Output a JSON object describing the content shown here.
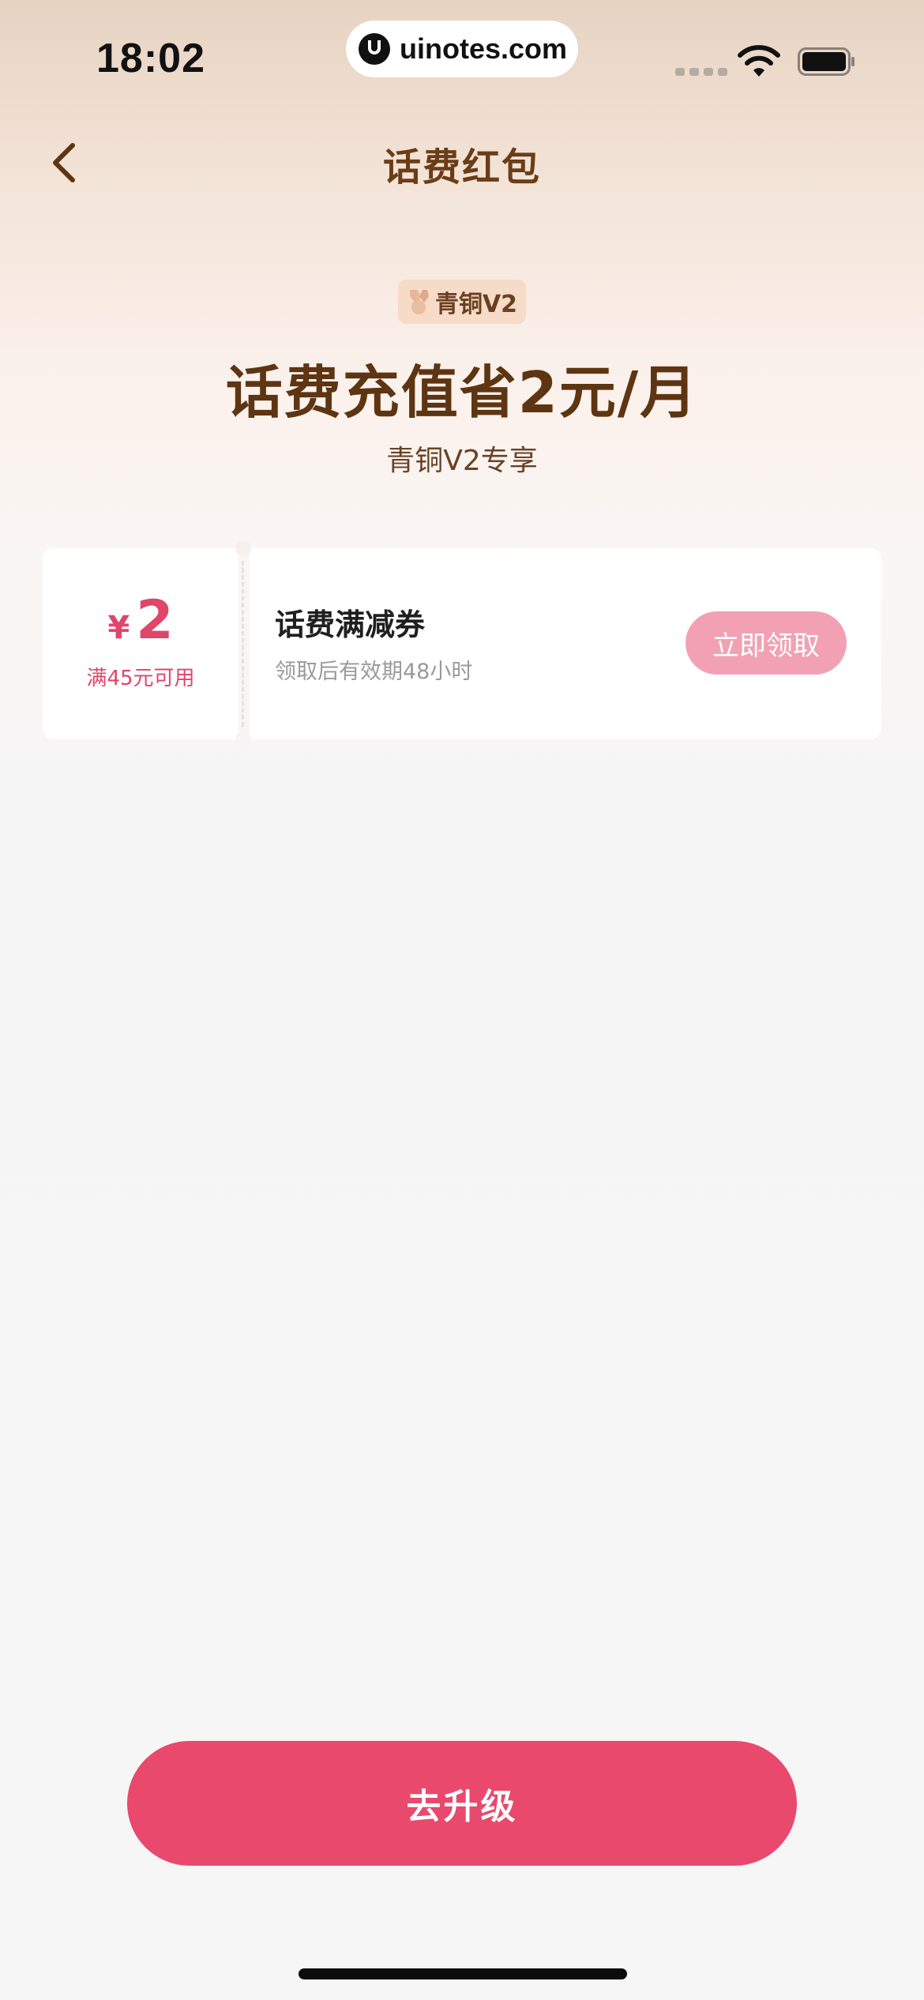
{
  "status_bar": {
    "time": "18:02",
    "url": "uinotes.com",
    "icons": [
      "signal-icon",
      "wifi-icon",
      "battery-icon"
    ]
  },
  "header": {
    "title": "话费红包",
    "back_icon": "chevron-left-icon"
  },
  "hero": {
    "level_badge": "青铜V2",
    "title": "话费充值省2元/月",
    "subtitle": "青铜V2专享"
  },
  "coupon": {
    "currency": "¥",
    "amount": "2",
    "condition": "满45元可用",
    "title": "话费满减券",
    "description": "领取后有效期48小时",
    "claim_label": "立即领取"
  },
  "footer": {
    "upgrade_label": "去升级"
  },
  "colors": {
    "brand_brown": "#5e3512",
    "accent_pink": "#e8496c",
    "claim_pink": "#f2a1b4",
    "badge_bg": "#f6dcc8"
  }
}
